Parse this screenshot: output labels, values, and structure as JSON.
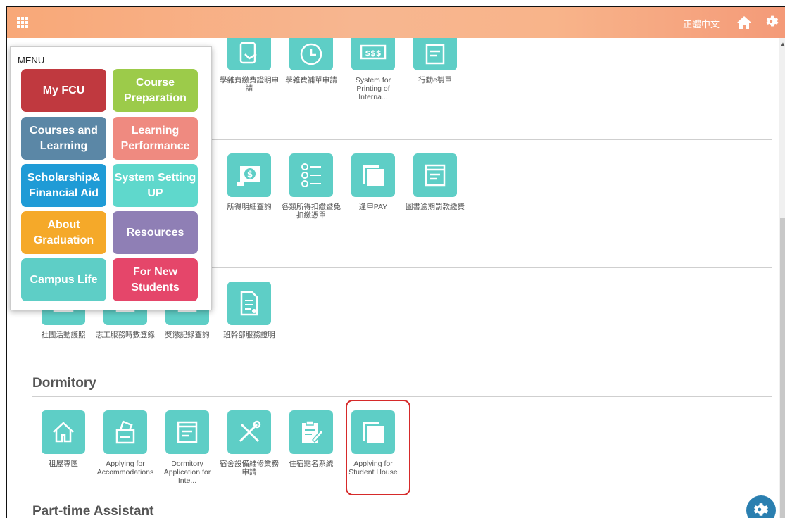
{
  "topbar": {
    "language_label": "正體中文"
  },
  "top_row": [
    {
      "label": "學雜費繳費證明申請"
    },
    {
      "label": "學雜費補單申請"
    },
    {
      "label": "System for Printing of Interna..."
    },
    {
      "label": "行動e製單"
    }
  ],
  "finance_row": [
    {
      "label": "所得明細查詢"
    },
    {
      "label": "各類所得扣繳暨免扣繳憑單"
    },
    {
      "label": "逢甲PAY"
    },
    {
      "label": "圖書逾期罰款繳費"
    }
  ],
  "activity_row": [
    {
      "label": "社團活動護照"
    },
    {
      "label": "志工服務時數登錄"
    },
    {
      "label": "獎懲記錄查詢"
    },
    {
      "label": "班幹部服務證明"
    }
  ],
  "dormitory": {
    "title": "Dormitory",
    "items": [
      {
        "label": "租屋專區"
      },
      {
        "label": "Applying for Accommodations"
      },
      {
        "label": "Dormitory Application for Inte..."
      },
      {
        "label": "宿舍設備維修業務申請"
      },
      {
        "label": "住宿點名系統"
      },
      {
        "label": "Applying for Student House"
      }
    ]
  },
  "part_time": {
    "title": "Part-time Assistant"
  },
  "menu": {
    "title": "MENU",
    "items": [
      {
        "label": "My FCU",
        "color": "#c0393f"
      },
      {
        "label": "Course Preparation",
        "color": "#9ccb4a"
      },
      {
        "label": "Courses and Learning",
        "color": "#5b87a6"
      },
      {
        "label": "Learning Performance",
        "color": "#ef8a80"
      },
      {
        "label": "Scholarship& Financial Aid",
        "color": "#1f9bd6"
      },
      {
        "label": "System Setting UP",
        "color": "#5fd8cc"
      },
      {
        "label": "About Graduation",
        "color": "#f5a929"
      },
      {
        "label": "Resources",
        "color": "#8f7fb5"
      },
      {
        "label": "Campus Life",
        "color": "#5ecec6"
      },
      {
        "label": "For New Students",
        "color": "#e5466a"
      }
    ]
  },
  "colors": {
    "tile": "#5ecec6",
    "highlight": "#d62a2a"
  }
}
